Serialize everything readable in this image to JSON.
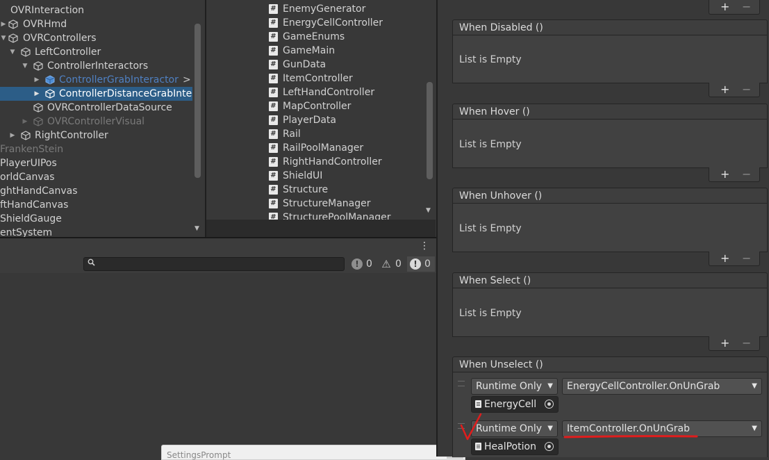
{
  "hierarchy": {
    "items": [
      {
        "label": "OVRInteraction",
        "arrow": "",
        "icon": false
      },
      {
        "label": "OVRHmd",
        "arrow": "▶",
        "icon": true
      },
      {
        "label": "OVRControllers",
        "arrow": "▼",
        "icon": true
      },
      {
        "label": "LeftController",
        "arrow": "▼",
        "icon": true
      },
      {
        "label": "ControllerInteractors",
        "arrow": "▼",
        "icon": true
      },
      {
        "label": "ControllerGrabInteractor",
        "arrow": "▶",
        "icon": true,
        "expand": ">"
      },
      {
        "label": "ControllerDistanceGrabInte",
        "arrow": "▶",
        "icon": true
      },
      {
        "label": "OVRControllerDataSource",
        "arrow": "",
        "icon": true
      },
      {
        "label": "OVRControllerVisual",
        "arrow": "▶",
        "icon": true
      },
      {
        "label": "RightController",
        "arrow": "▶",
        "icon": true
      },
      {
        "label": "FrankenStein",
        "arrow": "",
        "icon": false
      },
      {
        "label": "PlayerUIPos",
        "arrow": "",
        "icon": false
      },
      {
        "label": "orldCanvas",
        "arrow": "",
        "icon": false
      },
      {
        "label": "ghtHandCanvas",
        "arrow": "",
        "icon": false
      },
      {
        "label": "ftHandCanvas",
        "arrow": "",
        "icon": false
      },
      {
        "label": "ShieldGauge",
        "arrow": "",
        "icon": false
      },
      {
        "label": "entSystem",
        "arrow": "",
        "icon": false
      }
    ],
    "scroll_down": "▼"
  },
  "project": {
    "scripts": [
      "EnemyGenerator",
      "EnergyCellController",
      "GameEnums",
      "GameMain",
      "GunData",
      "ItemController",
      "LeftHandController",
      "MapController",
      "PlayerData",
      "Rail",
      "RailPoolManager",
      "RightHandController",
      "ShieldUI",
      "Structure",
      "StructureManager",
      "StructurePoolManager"
    ],
    "script_glyph": "#",
    "scroll_down": "▼"
  },
  "console": {
    "menu": "⋮",
    "search_icon": "🔍",
    "log_count": "0",
    "warning_count": "0",
    "error_count": "0",
    "log_glyph": "!",
    "warning_glyph": "⚠",
    "error_glyph": "!"
  },
  "settings_prompt": {
    "title": "SettingsPrompt"
  },
  "inspector": {
    "plus": "+",
    "minus": "−",
    "empty_text": "List is Empty",
    "events": [
      {
        "title": "When Disabled ()"
      },
      {
        "title": "When Hover ()"
      },
      {
        "title": "When Unhover ()"
      },
      {
        "title": "When Select ()"
      },
      {
        "title": "When Unselect ()"
      }
    ],
    "listeners": [
      {
        "mode": "Runtime Only",
        "function": "EnergyCellController.OnUnGrab",
        "target": "EnergyCell"
      },
      {
        "mode": "Runtime Only",
        "function": "ItemController.OnUnGrab",
        "target": "HealPotion"
      }
    ],
    "caret": "▼"
  },
  "colors": {
    "selection": "#2c5d87",
    "annotation": "#e01d1d",
    "background": "#383838"
  },
  "icons": {
    "gameobject": "cube-icon",
    "script": "hash-icon",
    "object_picker": "target-icon",
    "script_asset": "document-icon"
  }
}
